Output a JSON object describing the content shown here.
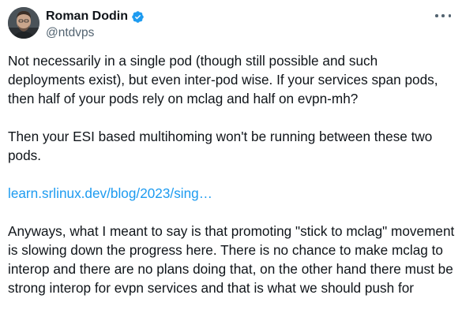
{
  "author": {
    "name": "Roman Dodin",
    "handle": "@ntdvps",
    "verified": true,
    "avatar_icon": "profile-photo"
  },
  "more_icon": "more-horizontal-icon",
  "colors": {
    "text": "#0f1419",
    "secondary": "#536471",
    "link": "#1d9bf0",
    "verified": "#1d9bf0"
  },
  "tweet": {
    "paragraphs": [
      "Not necessarily in a single pod (though still possible and such deployments exist), but even inter-pod wise. If your services span pods, then half of your pods rely on mclag and half on evpn-mh?",
      "Then your ESI based multihoming won't be running between these two pods.",
      "Anyways, what I meant to say is that promoting \"stick to mclag\" movement is slowing down the progress here. There is no chance to make mclag to interop and there are no plans doing that, on the other hand there must be strong interop for evpn services and that is what we should push for"
    ],
    "link_text": "learn.srlinux.dev/blog/2023/sing…"
  }
}
